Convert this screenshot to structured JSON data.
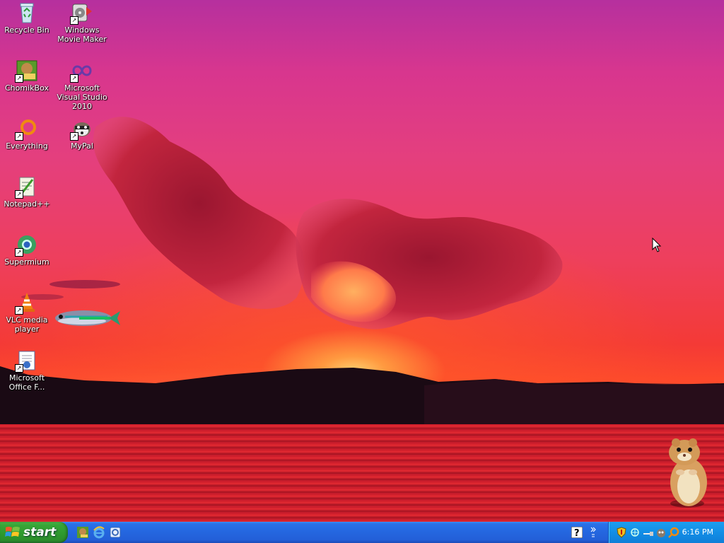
{
  "desktop": {
    "icons": [
      {
        "label": "Recycle Bin",
        "icon": "recycle-bin-icon"
      },
      {
        "label": "Windows Movie Maker",
        "icon": "movie-maker-icon"
      },
      {
        "label": "ChomikBox",
        "icon": "chomikbox-icon"
      },
      {
        "label": "Microsoft Visual Studio 2010",
        "icon": "visual-studio-icon"
      },
      {
        "label": "Everything",
        "icon": "everything-search-icon"
      },
      {
        "label": "MyPal",
        "icon": "mypal-browser-icon"
      },
      {
        "label": "Notepad++",
        "icon": "notepad-plus-plus-icon"
      },
      {
        "label": "Supermium",
        "icon": "supermium-browser-icon"
      },
      {
        "label": "VLC media player",
        "icon": "vlc-cone-icon"
      },
      {
        "label": "Microsoft Office F...",
        "icon": "office-document-icon"
      }
    ]
  },
  "taskbar": {
    "start_label": "start",
    "quick_launch": [
      "chomikbox-icon",
      "internet-explorer-icon",
      "outlook-express-icon"
    ],
    "tray_icons": [
      "security-shield-icon",
      "network-icon",
      "usb-icon",
      "pet-icon",
      "search-icon"
    ],
    "clock": "6:16 PM"
  },
  "colors": {
    "taskbar_blue": "#2466df",
    "start_green": "#38a638",
    "tray_blue": "#128ee6"
  }
}
